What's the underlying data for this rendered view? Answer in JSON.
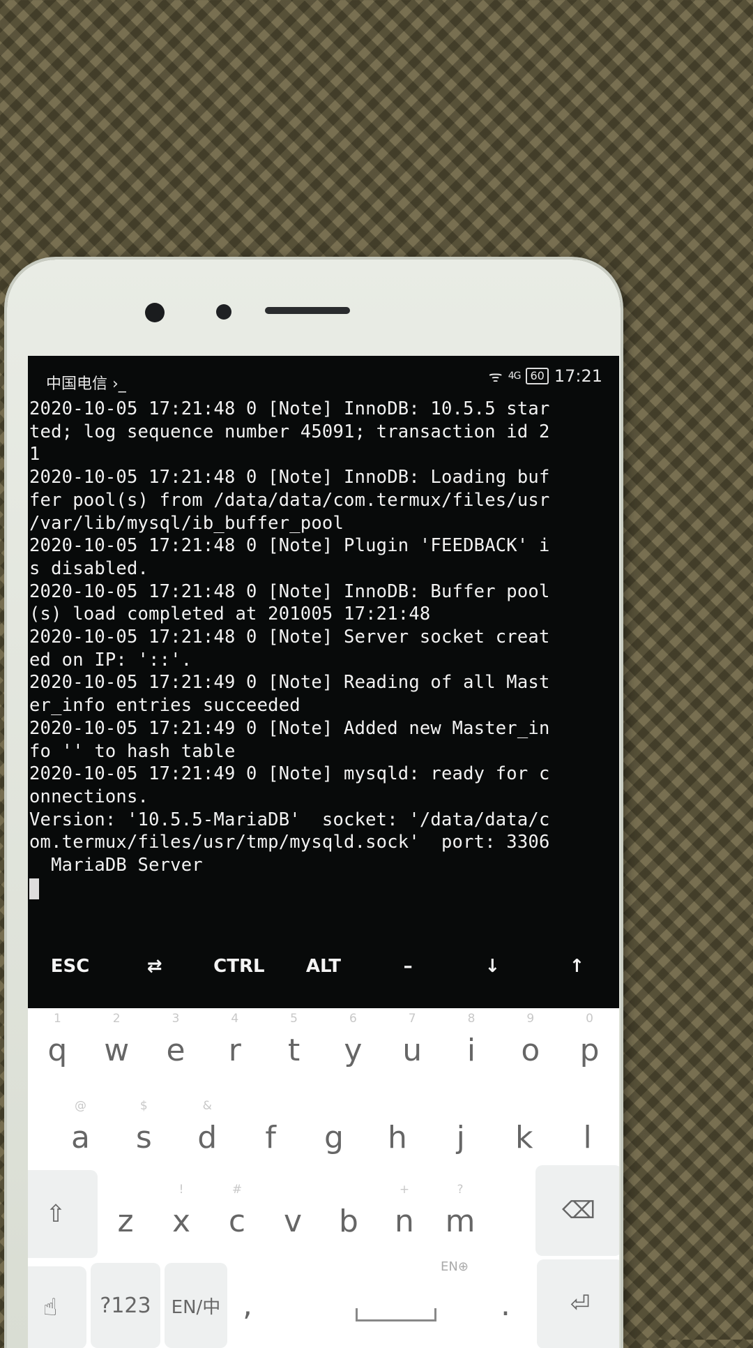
{
  "status_bar": {
    "carrier": "中国电信 ›_",
    "signal_label": "4G",
    "battery": "60",
    "time": "17:21"
  },
  "terminal": {
    "lines": [
      "2020-10-05 17:21:48 0 [Note] InnoDB: 10.5.5 star",
      "ted; log sequence number 45091; transaction id 2",
      "1",
      "2020-10-05 17:21:48 0 [Note] InnoDB: Loading buf",
      "fer pool(s) from /data/data/com.termux/files/usr",
      "/var/lib/mysql/ib_buffer_pool",
      "2020-10-05 17:21:48 0 [Note] Plugin 'FEEDBACK' i",
      "s disabled.",
      "2020-10-05 17:21:48 0 [Note] InnoDB: Buffer pool",
      "(s) load completed at 201005 17:21:48",
      "2020-10-05 17:21:48 0 [Note] Server socket creat",
      "ed on IP: '::'.",
      "2020-10-05 17:21:49 0 [Note] Reading of all Mast",
      "er_info entries succeeded",
      "2020-10-05 17:21:49 0 [Note] Added new Master_in",
      "fo '' to hash table",
      "2020-10-05 17:21:49 0 [Note] mysqld: ready for c",
      "onnections.",
      "Version: '10.5.5-MariaDB'  socket: '/data/data/c",
      "om.termux/files/usr/tmp/mysqld.sock'  port: 3306",
      "  MariaDB Server"
    ]
  },
  "extra_keys": [
    "ESC",
    "⇄",
    "CTRL",
    "ALT",
    "–",
    "↓",
    "↑"
  ],
  "keyboard": {
    "row1": [
      {
        "k": "q",
        "h": "1"
      },
      {
        "k": "w",
        "h": "2"
      },
      {
        "k": "e",
        "h": "3"
      },
      {
        "k": "r",
        "h": "4"
      },
      {
        "k": "t",
        "h": "5"
      },
      {
        "k": "y",
        "h": "6"
      },
      {
        "k": "u",
        "h": "7"
      },
      {
        "k": "i",
        "h": "8"
      },
      {
        "k": "o",
        "h": "9"
      },
      {
        "k": "p",
        "h": "0"
      }
    ],
    "row2": [
      {
        "k": "a",
        "h": "@"
      },
      {
        "k": "s",
        "h": "$"
      },
      {
        "k": "d",
        "h": "&"
      },
      {
        "k": "f",
        "h": ""
      },
      {
        "k": "g",
        "h": ""
      },
      {
        "k": "h",
        "h": ""
      },
      {
        "k": "j",
        "h": ""
      },
      {
        "k": "k",
        "h": ""
      },
      {
        "k": "l",
        "h": ""
      }
    ],
    "row3": [
      {
        "k": "z",
        "h": ""
      },
      {
        "k": "x",
        "h": "!"
      },
      {
        "k": "c",
        "h": "#"
      },
      {
        "k": "v",
        "h": ""
      },
      {
        "k": "b",
        "h": ""
      },
      {
        "k": "n",
        "h": "+"
      },
      {
        "k": "m",
        "h": "?"
      }
    ],
    "symbols_label": "?123",
    "lang_label": "EN/中",
    "comma": ",",
    "period": ".",
    "space_hint": "EN⊕"
  }
}
